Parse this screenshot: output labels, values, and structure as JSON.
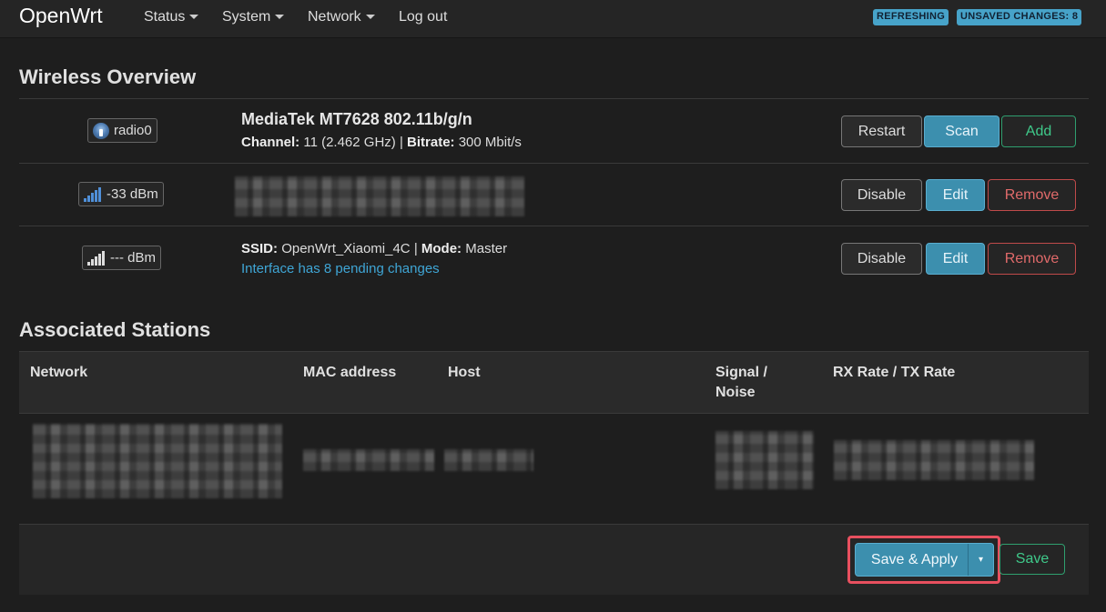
{
  "header": {
    "brand": "OpenWrt",
    "menu": [
      {
        "label": "Status"
      },
      {
        "label": "System"
      },
      {
        "label": "Network"
      },
      {
        "label": "Log out"
      }
    ],
    "badges": {
      "refreshing": "REFRESHING",
      "unsaved": "UNSAVED CHANGES: 8"
    }
  },
  "wireless": {
    "title": "Wireless Overview",
    "radio": {
      "name": "radio0",
      "device": "MediaTek MT7628 802.11b/g/n",
      "channel_label": "Channel:",
      "channel_value": "11 (2.462 GHz)",
      "separator": "|",
      "bitrate_label": "Bitrate:",
      "bitrate_value": "300 Mbit/s",
      "buttons": {
        "restart": "Restart",
        "scan": "Scan",
        "add": "Add"
      }
    },
    "networks": [
      {
        "signal": "-33 dBm",
        "buttons": {
          "disable": "Disable",
          "edit": "Edit",
          "remove": "Remove"
        }
      },
      {
        "signal": "--- dBm",
        "ssid_label": "SSID:",
        "ssid_value": "OpenWrt_Xiaomi_4C",
        "separator": "|",
        "mode_label": "Mode:",
        "mode_value": "Master",
        "pending": "Interface has 8 pending changes",
        "buttons": {
          "disable": "Disable",
          "edit": "Edit",
          "remove": "Remove"
        }
      }
    ]
  },
  "stations": {
    "title": "Associated Stations",
    "columns": {
      "network": "Network",
      "mac": "MAC address",
      "host": "Host",
      "signal_line1": "Signal /",
      "signal_line2": "Noise",
      "rate": "RX Rate / TX Rate"
    }
  },
  "footer": {
    "save_apply": "Save & Apply",
    "dropdown_glyph": "▾",
    "save": "Save"
  },
  "colors": {
    "accent": "#3c8fae",
    "success": "#3fc98a",
    "danger": "#e06a6a",
    "highlight": "#e8505f"
  }
}
